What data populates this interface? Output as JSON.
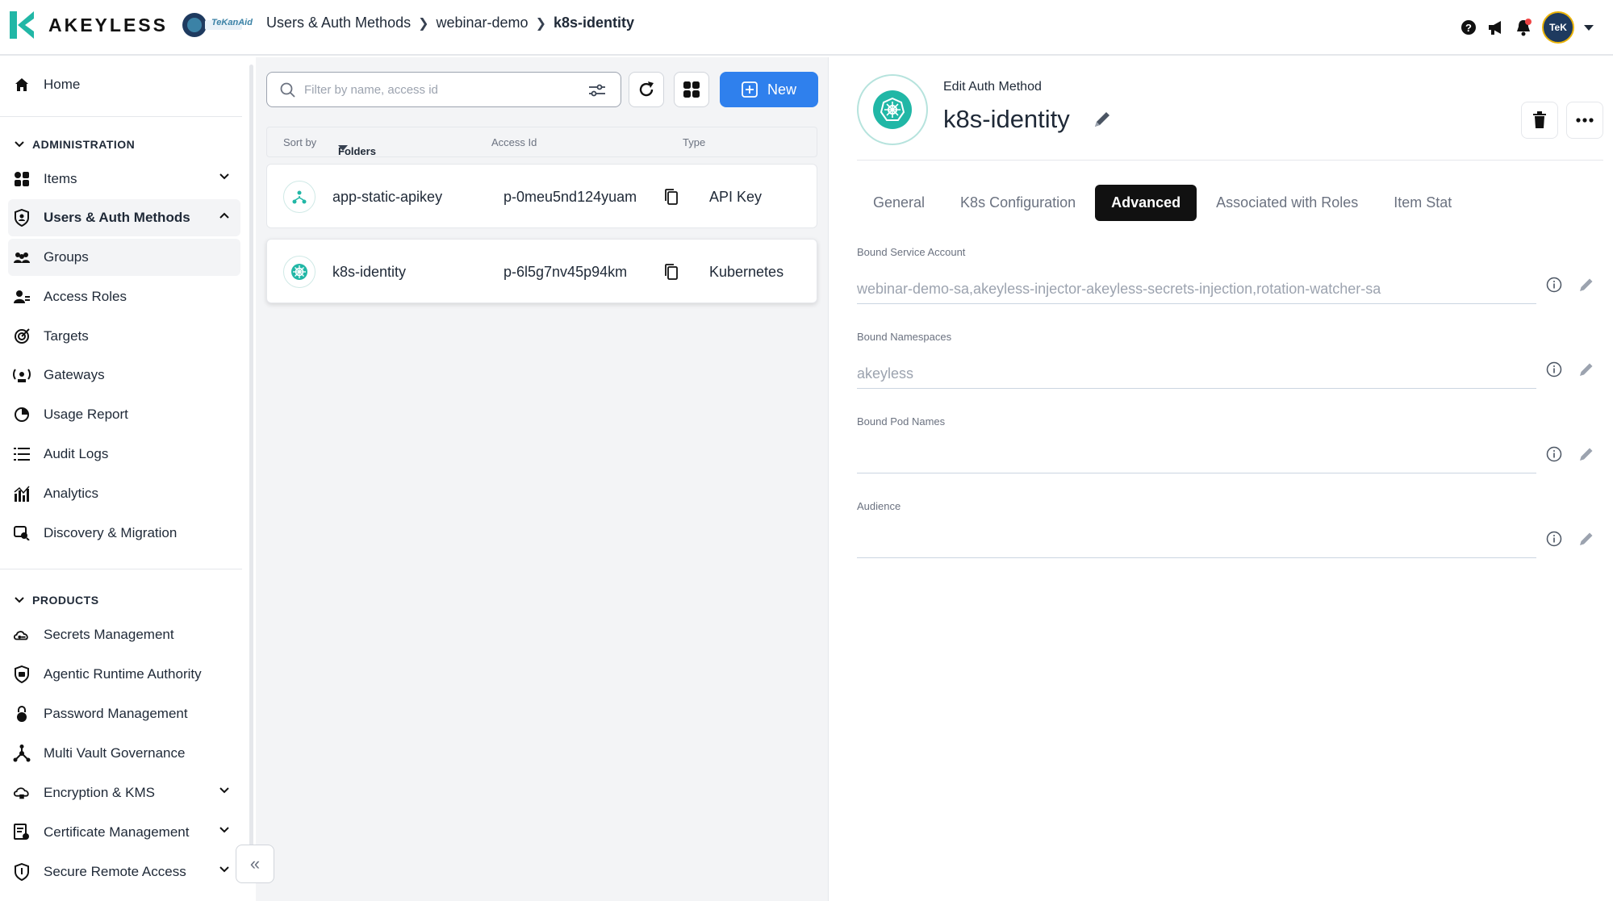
{
  "brand": {
    "name": "AKEYLESS",
    "partner": "TeKanAid",
    "accent": "#2f80ed",
    "teal": "#21b7a6"
  },
  "breadcrumb": [
    "Users & Auth Methods",
    "webinar-demo",
    "k8s-identity"
  ],
  "topbar": {
    "avatar": "TeK",
    "icons": [
      "help-icon",
      "megaphone-icon",
      "bell-icon"
    ]
  },
  "sidebar": {
    "home": "Home",
    "admin_section": "ADMINISTRATION",
    "admin_items": [
      {
        "label": "Items",
        "icon": "items-icon"
      },
      {
        "label": "Users & Auth Methods",
        "icon": "shield-user-icon"
      },
      {
        "label": "Groups",
        "icon": "groups-icon"
      },
      {
        "label": "Access Roles",
        "icon": "access-roles-icon"
      },
      {
        "label": "Targets",
        "icon": "targets-icon"
      },
      {
        "label": "Gateways",
        "icon": "gateways-icon"
      },
      {
        "label": "Usage Report",
        "icon": "pie-chart-icon"
      },
      {
        "label": "Audit Logs",
        "icon": "list-icon"
      },
      {
        "label": "Analytics",
        "icon": "analytics-icon"
      },
      {
        "label": "Discovery & Migration",
        "icon": "discovery-icon"
      }
    ],
    "products_section": "PRODUCTS",
    "product_items": [
      {
        "label": "Secrets Management",
        "icon": "key-cloud-icon"
      },
      {
        "label": "Agentic Runtime Authority",
        "icon": "agent-shield-icon"
      },
      {
        "label": "Password Management",
        "icon": "lock-icon"
      },
      {
        "label": "Multi Vault Governance",
        "icon": "network-icon"
      },
      {
        "label": "Encryption & KMS",
        "icon": "cloud-lock-icon"
      },
      {
        "label": "Certificate Management",
        "icon": "certificate-icon"
      },
      {
        "label": "Secure Remote Access",
        "icon": "remote-shield-icon"
      }
    ]
  },
  "list": {
    "search_placeholder": "Filter by name, access id",
    "new_label": "New",
    "sort_by": "Sort by",
    "sort_value": "Folders",
    "col_access_id": "Access Id",
    "col_type": "Type",
    "rows": [
      {
        "name": "app-static-apikey",
        "access_id": "p-0meu5nd124yuam",
        "type": "API Key"
      },
      {
        "name": "k8s-identity",
        "access_id": "p-6l5g7nv45p94km",
        "type": "Kubernetes"
      }
    ]
  },
  "detail": {
    "kicker": "Edit Auth Method",
    "title": "k8s-identity",
    "tabs": [
      "General",
      "K8s Configuration",
      "Advanced",
      "Associated with Roles",
      "Item Stat"
    ],
    "active_tab": "Advanced",
    "fields": [
      {
        "label": "Bound Service Account",
        "value": "webinar-demo-sa,akeyless-injector-akeyless-secrets-injection,rotation-watcher-sa"
      },
      {
        "label": "Bound Namespaces",
        "value": "akeyless"
      },
      {
        "label": "Bound Pod Names",
        "value": ""
      },
      {
        "label": "Audience",
        "value": ""
      }
    ]
  }
}
